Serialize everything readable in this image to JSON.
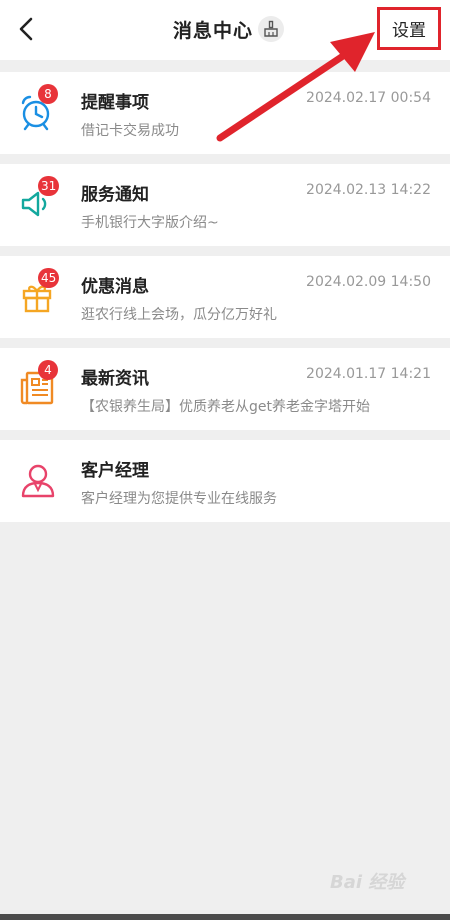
{
  "header": {
    "title": "消息中心",
    "settings_label": "设置"
  },
  "items": [
    {
      "name": "提醒事项",
      "time": "2024.02.17 00:54",
      "subtitle": "借记卡交易成功",
      "badge": "8",
      "icon": "alarm-clock-icon",
      "color": "#1a8fe3"
    },
    {
      "name": "服务通知",
      "time": "2024.02.13 14:22",
      "subtitle": "手机银行大字版介绍~",
      "badge": "31",
      "icon": "speaker-icon",
      "color": "#13a89e"
    },
    {
      "name": "优惠消息",
      "time": "2024.02.09 14:50",
      "subtitle": "逛农行线上会场，瓜分亿万好礼",
      "badge": "45",
      "icon": "gift-icon",
      "color": "#f5a623"
    },
    {
      "name": "最新资讯",
      "time": "2024.01.17 14:21",
      "subtitle": "【农银养生局】优质养老从get养老金字塔开始",
      "badge": "4",
      "icon": "newspaper-icon",
      "color": "#f08a24"
    },
    {
      "name": "客户经理",
      "time": "",
      "subtitle": "客户经理为您提供专业在线服务",
      "badge": "",
      "icon": "person-icon",
      "color": "#e8436a"
    }
  ],
  "watermark": "Bai 经验"
}
